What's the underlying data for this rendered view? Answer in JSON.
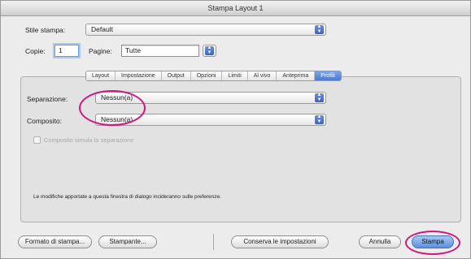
{
  "window": {
    "title": "Stampa Layout 1"
  },
  "style": {
    "label": "Stile stampa:",
    "value": "Default"
  },
  "copies": {
    "label": "Copie:",
    "value": "1"
  },
  "pages": {
    "label": "Pagine:",
    "value": "Tutte"
  },
  "tabs": [
    {
      "label": "Layout"
    },
    {
      "label": "Impostazione"
    },
    {
      "label": "Output"
    },
    {
      "label": "Opzioni"
    },
    {
      "label": "Limiti"
    },
    {
      "label": "Al vivo"
    },
    {
      "label": "Anteprima"
    },
    {
      "label": "Profili"
    }
  ],
  "active_tab": "Profili",
  "profiles": {
    "separation_label": "Separazione:",
    "separation_value": "Nessun(a)",
    "composite_label": "Composito:",
    "composite_value": "Nessun(a)",
    "simulate_label": "Composito simula la separazione"
  },
  "note": "Le modifiche apportate a questa finestra di dialogo incideranno sulle preferenze.",
  "buttons": {
    "page_setup": "Formato di stampa...",
    "printer": "Stampante...",
    "save_settings": "Conserva le impostazioni",
    "cancel": "Annulla",
    "print": "Stampa"
  },
  "colors": {
    "highlight_ring": "#d0167a",
    "accent": "#4a79d0"
  }
}
